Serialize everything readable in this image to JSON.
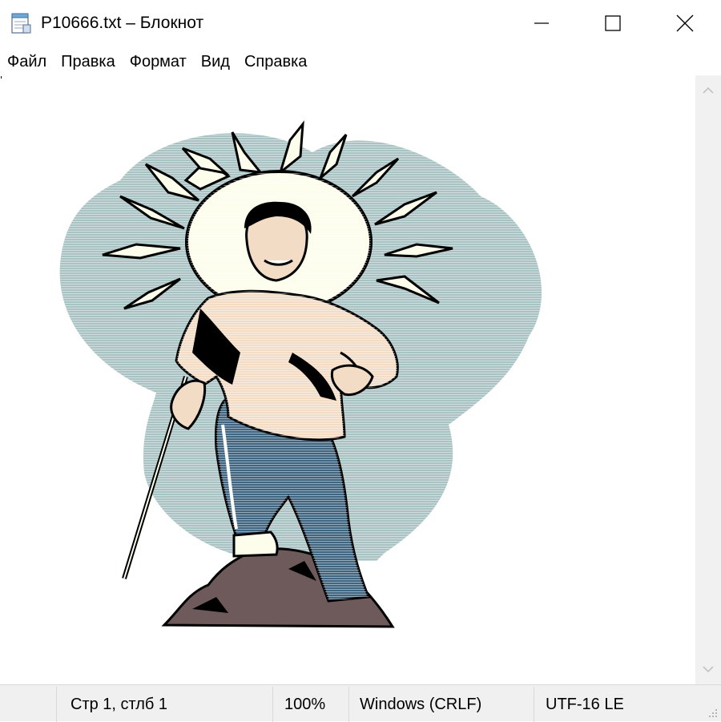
{
  "window": {
    "title": "P10666.txt – Блокнот",
    "icon": "notepad-icon",
    "controls": [
      "minimize-icon",
      "maximize-icon",
      "close-icon"
    ]
  },
  "menu": {
    "items": [
      {
        "label": "Файл"
      },
      {
        "label": "Правка"
      },
      {
        "label": "Формат"
      },
      {
        "label": "Вид"
      },
      {
        "label": "Справка"
      }
    ]
  },
  "editor": {
    "content": "ASCII-art picture: man with walking stick on a rock in front of a radiating sun"
  },
  "statusbar": {
    "position": "Стр 1, стлб 1",
    "zoom": "100%",
    "line_endings": "Windows (CRLF)",
    "encoding": "UTF-16 LE"
  },
  "colors": {
    "blob": "#a9c2c3",
    "sun": "#fdfdec",
    "skin": "#f3dcc6",
    "jeans": "#3f6580",
    "rock": "#6e5a5a",
    "statusbar_bg": "#f0f0f0"
  }
}
